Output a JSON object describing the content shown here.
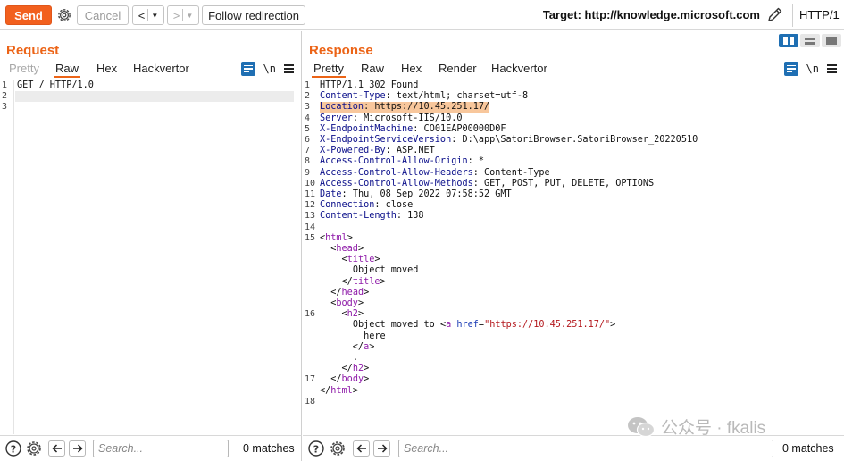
{
  "toolbar": {
    "send_label": "Send",
    "cancel_label": "Cancel",
    "back_label": "<",
    "forward_label": ">",
    "follow_label": "Follow redirection",
    "target": "Target: http://knowledge.microsoft.com",
    "http_version": "HTTP/1",
    "accent_color": "#f2601e"
  },
  "request": {
    "title": "Request",
    "tabs": [
      "Pretty",
      "Raw",
      "Hex",
      "Hackvertor"
    ],
    "active_tab": "Raw",
    "line_numbers": [
      "1",
      "2",
      "3"
    ],
    "lines": [
      "GET / HTTP/1.0",
      "",
      ""
    ]
  },
  "response": {
    "title": "Response",
    "tabs": [
      "Pretty",
      "Raw",
      "Hex",
      "Render",
      "Hackvertor"
    ],
    "active_tab": "Pretty",
    "status_line": "HTTP/1.1 302 Found",
    "headers": [
      {
        "name": "Content-Type",
        "value": " text/html; charset=utf-8"
      },
      {
        "name": "Location",
        "value": " https://10.45.251.17/"
      },
      {
        "name": "Server",
        "value": " Microsoft-IIS/10.0"
      },
      {
        "name": "X-EndpointMachine",
        "value": " CO01EAP00000D0F"
      },
      {
        "name": "X-EndpointServiceVersion",
        "value": " D:\\app\\SatoriBrowser.SatoriBrowser_20220510"
      },
      {
        "name": "X-Powered-By",
        "value": " ASP.NET"
      },
      {
        "name": "Access-Control-Allow-Origin",
        "value": " *"
      },
      {
        "name": "Access-Control-Allow-Headers",
        "value": " Content-Type"
      },
      {
        "name": "Access-Control-Allow-Methods",
        "value": " GET, POST, PUT, DELETE, OPTIONS"
      },
      {
        "name": "Date",
        "value": " Thu, 08 Sep 2022 07:58:52 GMT"
      },
      {
        "name": "Connection",
        "value": " close"
      },
      {
        "name": "Content-Length",
        "value": " 138"
      }
    ],
    "line_numbers": [
      "1",
      "2",
      "3",
      "4",
      "5",
      "6",
      "7",
      "8",
      "9",
      "10",
      "11",
      "12",
      "13",
      "14",
      "15",
      "16",
      "17",
      "18"
    ],
    "body": {
      "title_text": "Object moved",
      "h2_text": "Object moved to ",
      "href_attr": "href",
      "href_value": "\"https://10.45.251.17/\"",
      "link_text": "here",
      "dot": "."
    }
  },
  "bottom": {
    "search_placeholder": "Search...",
    "left_matches": "0 matches",
    "right_matches": "0 matches"
  },
  "watermark": "公众号 · fkalis"
}
